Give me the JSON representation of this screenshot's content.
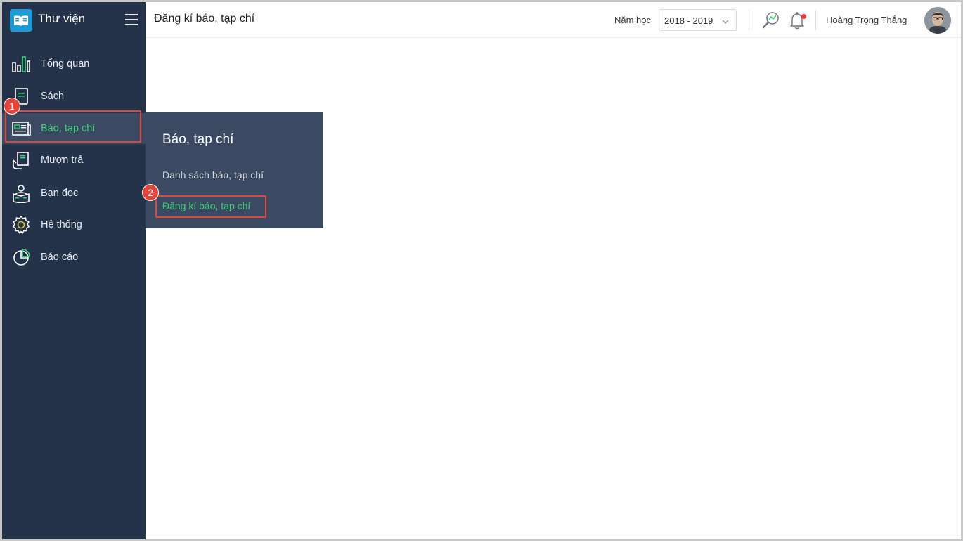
{
  "app": {
    "title": "Thư viện"
  },
  "sidebar": {
    "items": [
      {
        "label": "Tổng quan",
        "icon": "bar-chart-icon"
      },
      {
        "label": "Sách",
        "icon": "book-icon"
      },
      {
        "label": "Báo, tạp chí",
        "icon": "newspaper-icon",
        "active": true
      },
      {
        "label": "Mượn trả",
        "icon": "borrow-return-icon"
      },
      {
        "label": "Bạn đọc",
        "icon": "reader-icon"
      },
      {
        "label": "Hệ thống",
        "icon": "gear-icon"
      },
      {
        "label": "Báo cáo",
        "icon": "pie-chart-icon"
      }
    ]
  },
  "header": {
    "page_title": "Đăng kí báo, tạp chí",
    "year_label": "Năm học",
    "year_value": "2018 - 2019",
    "user_name": "Hoàng Trọng  Thắng"
  },
  "flyout": {
    "title": "Báo, tạp chí",
    "items": [
      {
        "label": "Danh sách báo, tạp chí"
      },
      {
        "label": "Đăng kí báo, tạp chí",
        "active": true
      }
    ]
  },
  "annotations": [
    {
      "label": "1"
    },
    {
      "label": "2"
    }
  ],
  "colors": {
    "sidebar_bg": "#24324a",
    "active_bg": "#3b4a62",
    "accent_green": "#3fd07a",
    "annotation_red": "#e0463b",
    "logo_blue": "#1e9bd7"
  }
}
